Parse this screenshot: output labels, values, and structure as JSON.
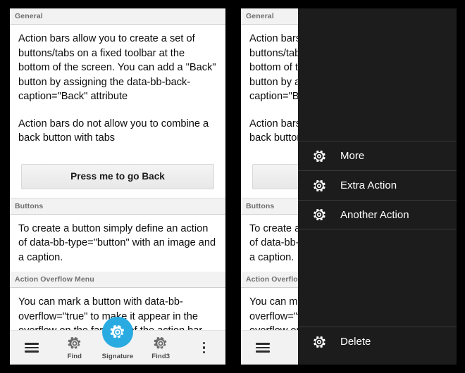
{
  "app": {
    "featured_accent": "#29abe2",
    "overlay_bg": "#1c1c1c",
    "panel_bg": "#ffffff"
  },
  "sections": [
    {
      "header": "General",
      "paragraphs": [
        "Action bars allow you to create a set of buttons/tabs on a fixed toolbar at the bottom of the screen. You can add a \"Back\" button by assigning the data-bb-back-caption=\"Back\" attribute",
        "Action bars do not allow you to combine a back button with tabs"
      ],
      "button_label": "Press me to go Back"
    },
    {
      "header": "Buttons",
      "paragraphs": [
        "To create a button simply define an action of data-bb-type=\"button\" with an image and a caption."
      ]
    },
    {
      "header": "Action Overflow Menu",
      "paragraphs": [
        "You can mark a button with data-bb-overflow=\"true\" to make it appear in the overflow on the far right of the action bar"
      ]
    }
  ],
  "action_bar": {
    "items": [
      {
        "icon": "hamburger-icon",
        "label": ""
      },
      {
        "icon": "gear-icon",
        "label": "Find"
      },
      {
        "icon": "gear-icon",
        "label": "Signature",
        "featured": true
      },
      {
        "icon": "gear-icon",
        "label": "Find3"
      },
      {
        "icon": "kebab-overflow-icon",
        "label": ""
      }
    ]
  },
  "overflow_menu": {
    "items": [
      {
        "icon": "gear-icon",
        "label": "More"
      },
      {
        "icon": "gear-icon",
        "label": "Extra Action"
      },
      {
        "icon": "gear-icon",
        "label": "Another Action"
      }
    ],
    "bottom_item": {
      "icon": "gear-icon",
      "label": "Delete"
    }
  }
}
